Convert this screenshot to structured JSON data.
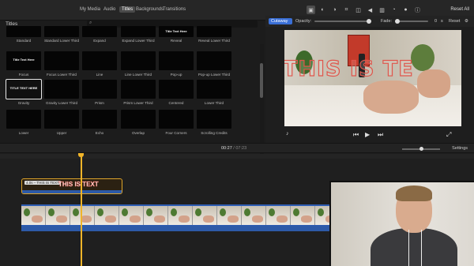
{
  "top_tabs": {
    "my_media": "My Media",
    "audio": "Audio",
    "titles": "Titles",
    "backgrounds": "Backgrounds",
    "transitions": "Transitions"
  },
  "reset_all": "Reset All",
  "browser": {
    "heading": "Titles",
    "tiles": [
      {
        "label": "Standard",
        "preview": ""
      },
      {
        "label": "Standard Lower Third",
        "preview": ""
      },
      {
        "label": "Expand",
        "preview": ""
      },
      {
        "label": "Expand Lower Third",
        "preview": ""
      },
      {
        "label": "Reveal",
        "preview": "Title Text Here"
      },
      {
        "label": "Reveal Lower Third",
        "preview": ""
      },
      {
        "label": "Focus",
        "preview": "Title Text Here"
      },
      {
        "label": "Focus Lower Third",
        "preview": ""
      },
      {
        "label": "Line",
        "preview": ""
      },
      {
        "label": "Line Lower Third",
        "preview": ""
      },
      {
        "label": "Pop-up",
        "preview": ""
      },
      {
        "label": "Pop-up Lower Third",
        "preview": ""
      },
      {
        "label": "Gravity",
        "preview": "TITLE TEXT HERE"
      },
      {
        "label": "Gravity Lower Third",
        "preview": ""
      },
      {
        "label": "Prism",
        "preview": ""
      },
      {
        "label": "Prism Lower Third",
        "preview": ""
      },
      {
        "label": "Centered",
        "preview": ""
      },
      {
        "label": "Lower Third",
        "preview": ""
      },
      {
        "label": "Lower",
        "preview": ""
      },
      {
        "label": "Upper",
        "preview": ""
      },
      {
        "label": "Echo",
        "preview": ""
      },
      {
        "label": "Overlap",
        "preview": ""
      },
      {
        "label": "Four Corners",
        "preview": ""
      },
      {
        "label": "Scrolling Credits",
        "preview": ""
      }
    ]
  },
  "viewer": {
    "mode": "Cutaway",
    "opacity_label": "Opacity:",
    "fade_label": "Fade:",
    "fade_value": "0",
    "fade_unit": "s",
    "reset": "Reset",
    "overlay_text": "THIS IS TE"
  },
  "timecode": {
    "current": "00:27",
    "separator": "/",
    "duration": "07:23"
  },
  "settings": "Settings",
  "timeline": {
    "title_clip_text": "THIS IS TEXT",
    "title_clip_label": "4.0s – THIS IS TEXT"
  },
  "colors": {
    "accent_blue": "#3a6fd6",
    "playhead": "#f0b429",
    "title_stroke": "#e0564c",
    "clip_border": "#e0a52a"
  }
}
